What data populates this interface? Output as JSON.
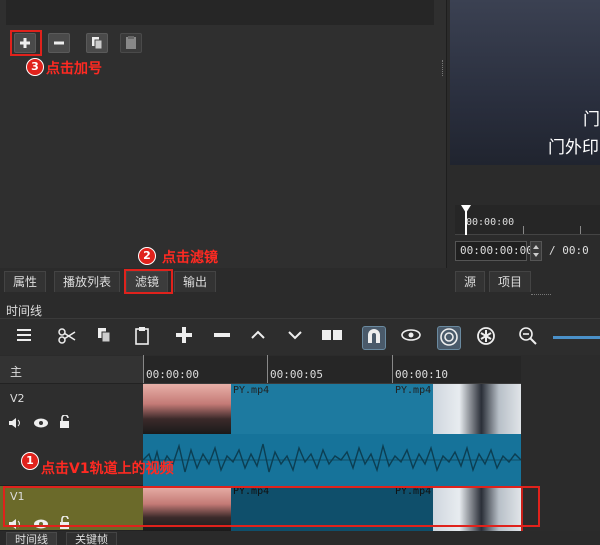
{
  "filter_toolbar": {
    "add_label": "+",
    "remove_label": "−"
  },
  "annotations": {
    "step1": {
      "num": "1",
      "text": "点击V1轨道上的视频"
    },
    "step2": {
      "num": "2",
      "text": "点击滤镜"
    },
    "step3": {
      "num": "3",
      "text": "点击加号"
    }
  },
  "viewer": {
    "subtitle_line1": "门",
    "subtitle_line2": "门外印",
    "timecode_ruler": "00:00:00",
    "current_time": "00:00:00:00",
    "duration_prefix": "/ 00:0"
  },
  "panel_tabs": [
    {
      "label": "属性"
    },
    {
      "label": "播放列表"
    },
    {
      "label": "滤镜"
    },
    {
      "label": "输出"
    }
  ],
  "viewer_tabs": [
    {
      "label": "源"
    },
    {
      "label": "项目"
    }
  ],
  "timeline": {
    "title": "时间线",
    "ruler_labels": [
      "00:00:00",
      "00:00:05",
      "00:00:10"
    ],
    "tracks": [
      {
        "name": "主"
      },
      {
        "name": "V2"
      },
      {
        "name": "V1"
      }
    ],
    "clip_name": "PY.mp4"
  },
  "bottom_tabs": [
    {
      "label": "时间线"
    },
    {
      "label": "关键帧"
    }
  ],
  "colors": {
    "accent_red": "#e0221c",
    "clip_blue": "#1d7aa0",
    "v1_selected": "#6b6a2a"
  }
}
